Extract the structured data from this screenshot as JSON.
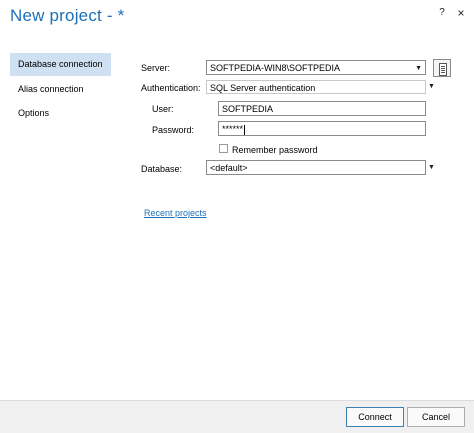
{
  "window": {
    "title": "New project - *",
    "help_glyph": "?",
    "close_glyph": "×"
  },
  "nav": {
    "items": [
      {
        "label": "Database connection",
        "active": true
      },
      {
        "label": "Alias connection",
        "active": false
      },
      {
        "label": "Options",
        "active": false
      }
    ]
  },
  "form": {
    "server_label": "Server:",
    "server_value": "SOFTPEDIA-WIN8\\SOFTPEDIA",
    "authentication_label": "Authentication:",
    "authentication_value": "SQL Server authentication",
    "user_label": "User:",
    "user_value": "SOFTPEDIA",
    "password_label": "Password:",
    "password_value": "******",
    "remember_label": "Remember password",
    "remember_checked": false,
    "database_label": "Database:",
    "database_value": "<default>"
  },
  "links": {
    "recent_projects": "Recent projects"
  },
  "footer": {
    "connect_label": "Connect",
    "cancel_label": "Cancel"
  },
  "icons": {
    "dropdown": "chevron-down-icon",
    "browse": "document-icon"
  },
  "colors": {
    "accent": "#1e6fb8",
    "nav_active_bg": "#cfe0f2"
  }
}
